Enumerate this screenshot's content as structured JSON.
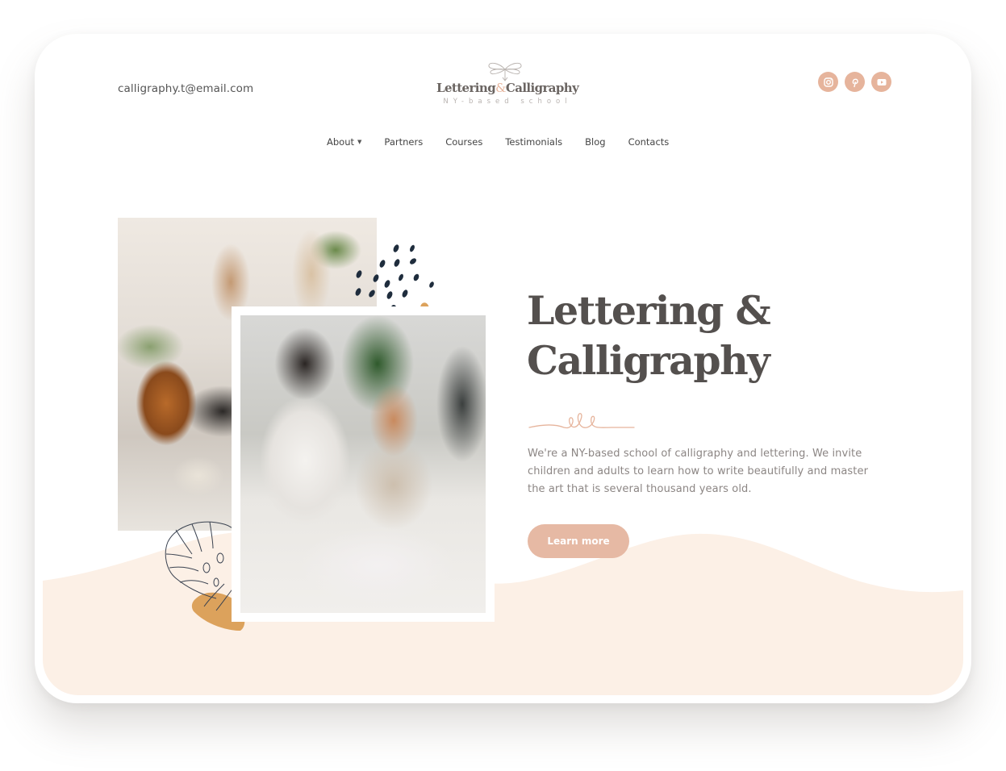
{
  "header": {
    "email": "calligraphy.t@email.com",
    "logo": {
      "title_part1": "Lettering",
      "ampersand": "&",
      "title_part2": "Calligraphy",
      "subtitle": "NY-based school",
      "ornament_icon": "flourish-ornament-icon"
    },
    "social": [
      {
        "name": "instagram",
        "icon": "instagram-icon"
      },
      {
        "name": "pinterest",
        "icon": "pinterest-icon"
      },
      {
        "name": "youtube",
        "icon": "youtube-icon"
      }
    ]
  },
  "nav": {
    "items": [
      {
        "label": "About",
        "has_dropdown": true
      },
      {
        "label": "Partners"
      },
      {
        "label": "Courses"
      },
      {
        "label": "Testimonials"
      },
      {
        "label": "Blog"
      },
      {
        "label": "Contacts"
      }
    ],
    "caret": "▼"
  },
  "hero": {
    "title_line1": "Lettering &",
    "title_line2": "Calligraphy",
    "description": "We're a NY-based school of calligraphy and lettering. We invite children and adults to learn how to write beautifully and master the art that is several thousand years old.",
    "cta_label": "Learn more",
    "images": [
      {
        "alt": "Calligraphy tools, ink jars and brushes on a table"
      },
      {
        "alt": "Two women practicing lettering at a table"
      }
    ]
  },
  "colors": {
    "accent": "#e6b49c",
    "button": "#e6b9a4",
    "wave": "#fcf0e6",
    "title": "#54504e",
    "body_text": "#8c8684",
    "dots": "#1f2d3d",
    "ochre": "#dca25c"
  }
}
